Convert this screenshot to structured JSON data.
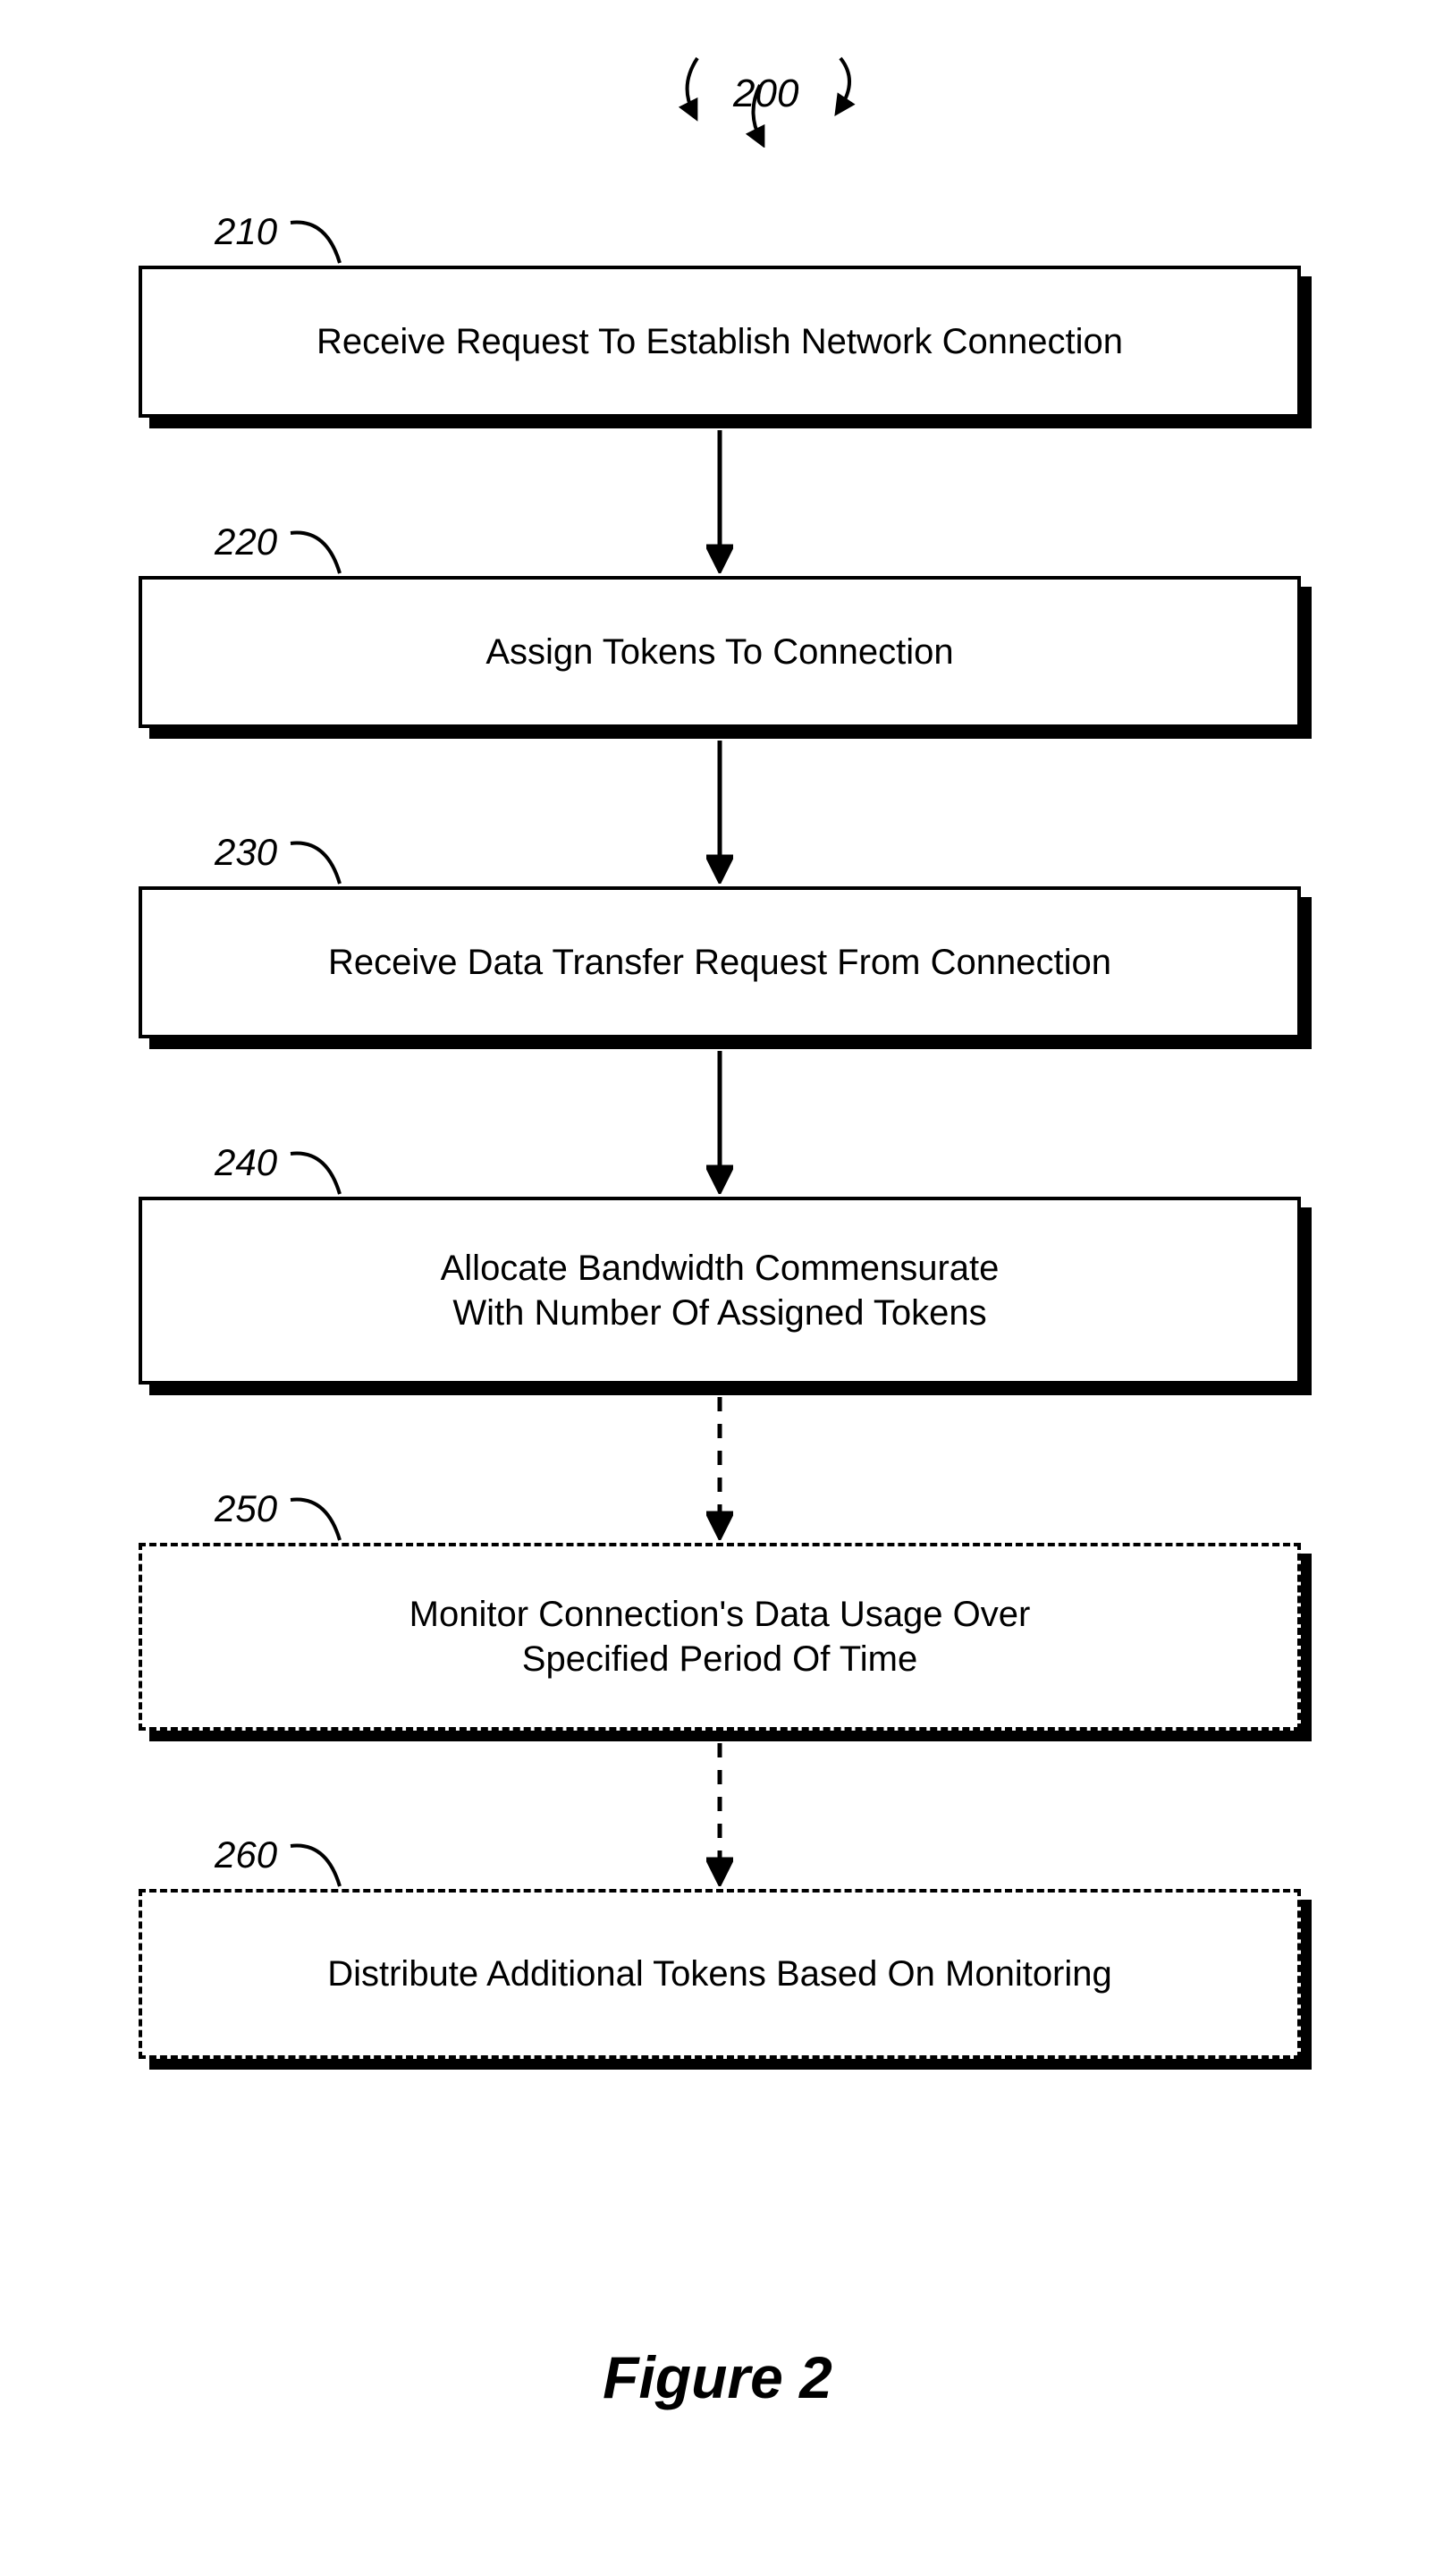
{
  "figure_number_label": "200",
  "caption": "Figure 2",
  "steps": [
    {
      "num": "210",
      "text": "Receive Request To Establish Network Connection"
    },
    {
      "num": "220",
      "text": "Assign Tokens To Connection"
    },
    {
      "num": "230",
      "text": "Receive Data Transfer Request From Connection"
    },
    {
      "num": "240",
      "text": "Allocate Bandwidth Commensurate\nWith Number Of Assigned Tokens"
    },
    {
      "num": "250",
      "text": "Monitor Connection's Data Usage Over\nSpecified Period Of Time"
    },
    {
      "num": "260",
      "text": "Distribute Additional Tokens Based On Monitoring"
    }
  ]
}
